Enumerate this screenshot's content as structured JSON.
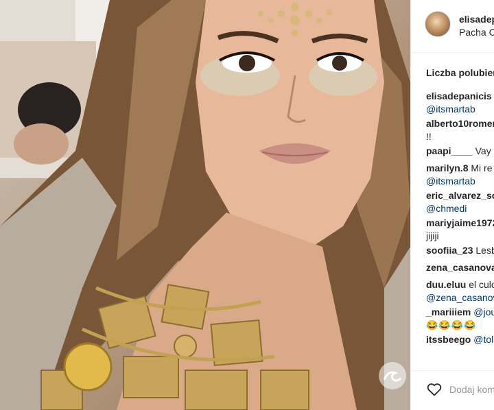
{
  "post": {
    "username": "elisadep",
    "location": "Pacha C",
    "likes_label": "Liczba polubień"
  },
  "comments": [
    {
      "lines": [
        [
          {
            "t": "elisadepanicis",
            "k": "user"
          }
        ],
        [
          {
            "t": "@itsmartab",
            "k": "mention"
          }
        ]
      ]
    },
    {
      "lines": [
        [
          {
            "t": "alberto10romer",
            "k": "user"
          }
        ],
        [
          {
            "t": "!!",
            "k": "text"
          }
        ]
      ]
    },
    {
      "lines": [
        [
          {
            "t": "paapi____",
            "k": "user"
          },
          {
            "t": " Vay",
            "k": "text"
          }
        ]
      ]
    },
    {
      "lines": [
        [
          {
            "t": "marilyn.8",
            "k": "user"
          },
          {
            "t": " Mi re",
            "k": "text"
          }
        ],
        [
          {
            "t": "@itsmartab",
            "k": "mention"
          }
        ]
      ]
    },
    {
      "lines": [
        [
          {
            "t": "eric_alvarez_sc",
            "k": "user"
          }
        ],
        [
          {
            "t": "@chmedi",
            "k": "mention"
          }
        ]
      ]
    },
    {
      "lines": [
        [
          {
            "t": "mariyjaime1972",
            "k": "user"
          }
        ],
        [
          {
            "t": "jijiji",
            "k": "text"
          }
        ]
      ]
    },
    {
      "lines": [
        [
          {
            "t": "soofiia_23",
            "k": "user"
          },
          {
            "t": " Lesb",
            "k": "text"
          }
        ]
      ]
    },
    {
      "lines": [
        [
          {
            "t": "zena_casanova",
            "k": "user"
          }
        ]
      ]
    },
    {
      "lines": [
        [
          {
            "t": "duu.eluu",
            "k": "user"
          },
          {
            "t": " el culo",
            "k": "text"
          }
        ],
        [
          {
            "t": "@zena_casanov",
            "k": "mention"
          }
        ]
      ]
    },
    {
      "lines": [
        [
          {
            "t": "_mariiiem",
            "k": "user"
          },
          {
            "t": " ",
            "k": "text"
          },
          {
            "t": "@jou",
            "k": "mention"
          }
        ],
        [
          {
            "t": "😂😂😂😂",
            "k": "emoji"
          }
        ]
      ]
    },
    {
      "lines": [
        [
          {
            "t": "itssbeego",
            "k": "user"
          },
          {
            "t": " ",
            "k": "text"
          },
          {
            "t": "@toli",
            "k": "mention"
          }
        ]
      ]
    }
  ],
  "actions": {
    "like_icon": "heart-outline-icon",
    "comment_placeholder": "Dodaj kom"
  },
  "photo": {
    "watermark_icon": "wave-logo-icon"
  },
  "colors": {
    "text": "#262626",
    "mention": "#003569",
    "border": "#efefef",
    "placeholder": "#999999"
  }
}
